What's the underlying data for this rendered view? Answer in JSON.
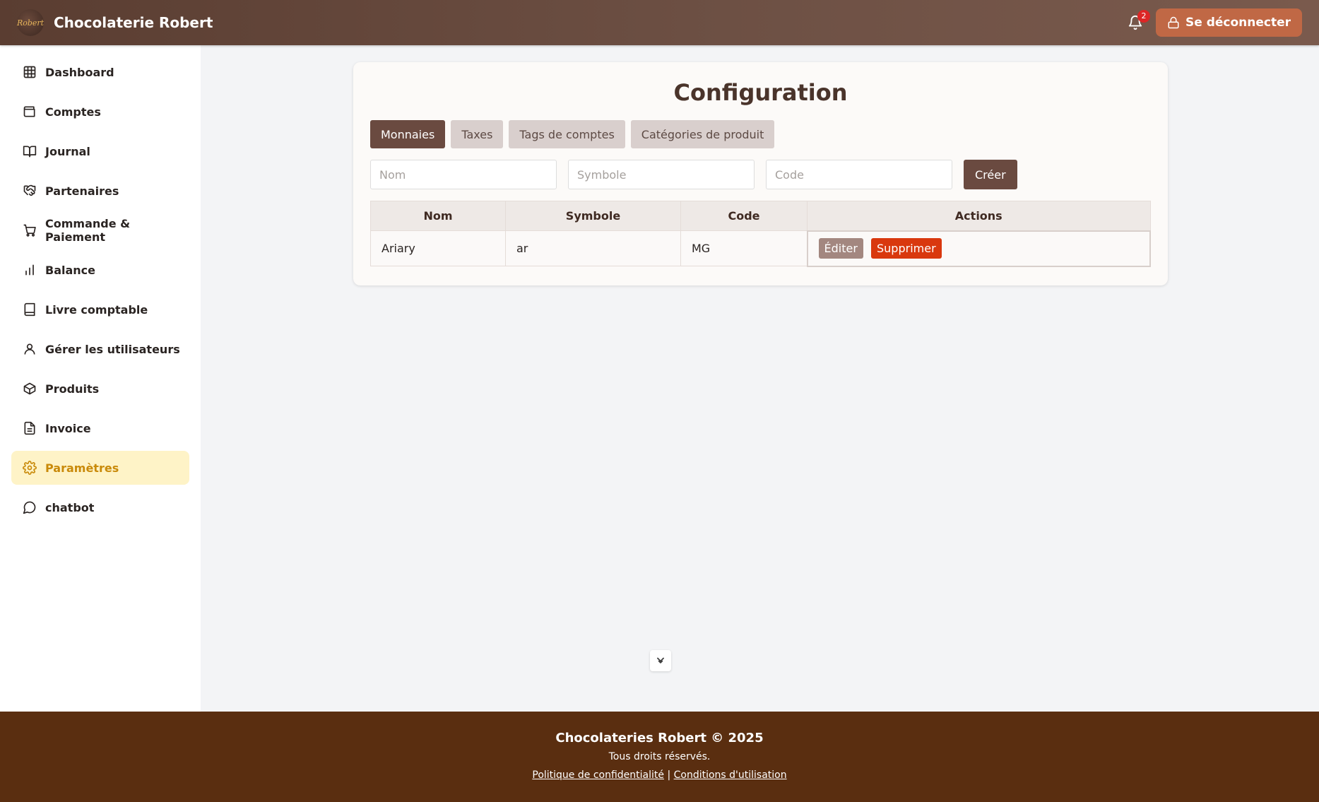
{
  "header": {
    "logo_text": "Robert",
    "brand": "Chocolaterie Robert",
    "notification_count": "2",
    "logout_label": "Se déconnecter"
  },
  "sidebar": {
    "items": [
      {
        "label": "Dashboard",
        "icon": "grid-icon"
      },
      {
        "label": "Comptes",
        "icon": "wallet-icon"
      },
      {
        "label": "Journal",
        "icon": "book-open-icon"
      },
      {
        "label": "Partenaires",
        "icon": "handshake-icon"
      },
      {
        "label": "Commande & Paiement",
        "icon": "cart-icon"
      },
      {
        "label": "Balance",
        "icon": "bar-chart-icon"
      },
      {
        "label": "Livre comptable",
        "icon": "book-icon"
      },
      {
        "label": "Gérer les utilisateurs",
        "icon": "user-icon"
      },
      {
        "label": "Produits",
        "icon": "box-icon"
      },
      {
        "label": "Invoice",
        "icon": "file-text-icon"
      },
      {
        "label": "Paramètres",
        "icon": "gear-icon",
        "active": true
      },
      {
        "label": "chatbot",
        "icon": "chat-bubble-icon"
      }
    ]
  },
  "main": {
    "title": "Configuration",
    "tabs": [
      {
        "label": "Monnaies",
        "active": true
      },
      {
        "label": "Taxes"
      },
      {
        "label": "Tags de comptes"
      },
      {
        "label": "Catégories de produit"
      }
    ],
    "form": {
      "nom_placeholder": "Nom",
      "symbole_placeholder": "Symbole",
      "code_placeholder": "Code",
      "create_label": "Créer"
    },
    "table": {
      "headers": [
        "Nom",
        "Symbole",
        "Code",
        "Actions"
      ],
      "rows": [
        {
          "nom": "Ariary",
          "symbole": "ar",
          "code": "MG",
          "edit_label": "Éditer",
          "delete_label": "Supprimer"
        }
      ]
    }
  },
  "footer": {
    "title": "Chocolateries Robert © 2025",
    "subtitle": "Tous droits réservés.",
    "privacy_link": "Politique de confidentialité",
    "separator": "|",
    "terms_link": "Conditions d'utilisation"
  },
  "colors": {
    "header_bg": "#5a3d31",
    "accent_button": "#c06845",
    "primary_brown": "#6a4a40",
    "active_nav_bg": "#fef3c7",
    "active_nav_text": "#c98a0a",
    "delete_red": "#d9380e",
    "footer_bg": "#5a2e10"
  }
}
